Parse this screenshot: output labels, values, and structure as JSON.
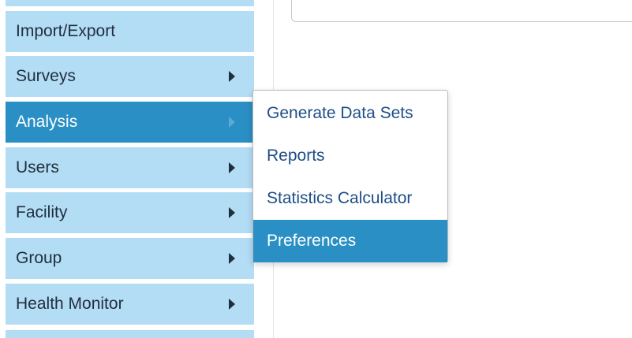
{
  "sidebar": {
    "items": [
      {
        "label": "Import/Export",
        "has_submenu": false,
        "active": false
      },
      {
        "label": "Surveys",
        "has_submenu": true,
        "active": false
      },
      {
        "label": "Analysis",
        "has_submenu": true,
        "active": true
      },
      {
        "label": "Users",
        "has_submenu": true,
        "active": false
      },
      {
        "label": "Facility",
        "has_submenu": true,
        "active": false
      },
      {
        "label": "Group",
        "has_submenu": true,
        "active": false
      },
      {
        "label": "Health Monitor",
        "has_submenu": true,
        "active": false
      }
    ]
  },
  "submenu": {
    "parent": "Analysis",
    "items": [
      {
        "label": "Generate Data Sets",
        "active": false
      },
      {
        "label": "Reports",
        "active": false
      },
      {
        "label": "Statistics Calculator",
        "active": false
      },
      {
        "label": "Preferences",
        "active": true
      }
    ]
  },
  "colors": {
    "sidebar_bg": "#b3dcf5",
    "active_bg": "#2a8fc4",
    "submenu_text": "#1e4e86",
    "sidebar_text": "#1f2f3d"
  }
}
